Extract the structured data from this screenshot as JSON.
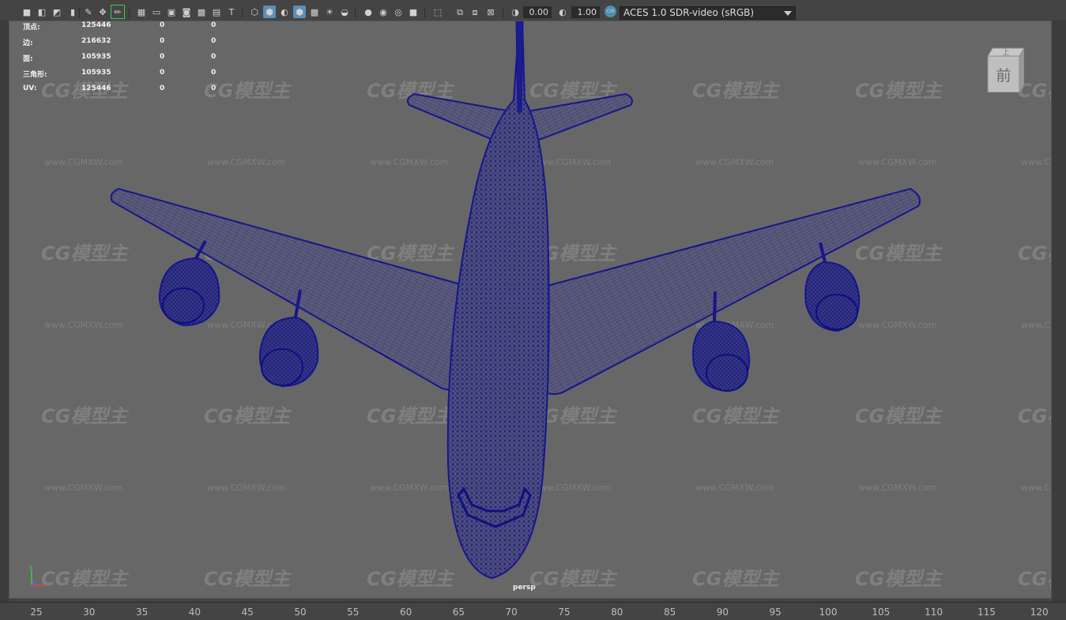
{
  "toolbar": {
    "exposure_value": "0.00",
    "gamma_value": "1.00",
    "color_transform": "ACES 1.0 SDR-video (sRGB)",
    "accent_color": "#5a8fb8"
  },
  "hud": {
    "stats": [
      {
        "label": "顶点:",
        "value": "125446",
        "sel": "0",
        "tri": "0"
      },
      {
        "label": "边:",
        "value": "216632",
        "sel": "0",
        "tri": "0"
      },
      {
        "label": "面:",
        "value": "105935",
        "sel": "0",
        "tri": "0"
      },
      {
        "label": "三角形:",
        "value": "105935",
        "sel": "0",
        "tri": "0"
      },
      {
        "label": "UV:",
        "value": "125446",
        "sel": "0",
        "tri": "0"
      }
    ]
  },
  "viewport": {
    "camera_label": "persp",
    "viewcube_top": "上",
    "viewcube_front": "前",
    "watermark_logo": "CG模型主",
    "watermark_url": "www.CGMXW.com",
    "wire_color": "#1a1a8c"
  },
  "ruler": {
    "ticks": [
      "25",
      "30",
      "35",
      "40",
      "45",
      "50",
      "55",
      "60",
      "65",
      "70",
      "75",
      "80",
      "85",
      "90",
      "95",
      "100",
      "105",
      "110",
      "115",
      "120"
    ]
  }
}
